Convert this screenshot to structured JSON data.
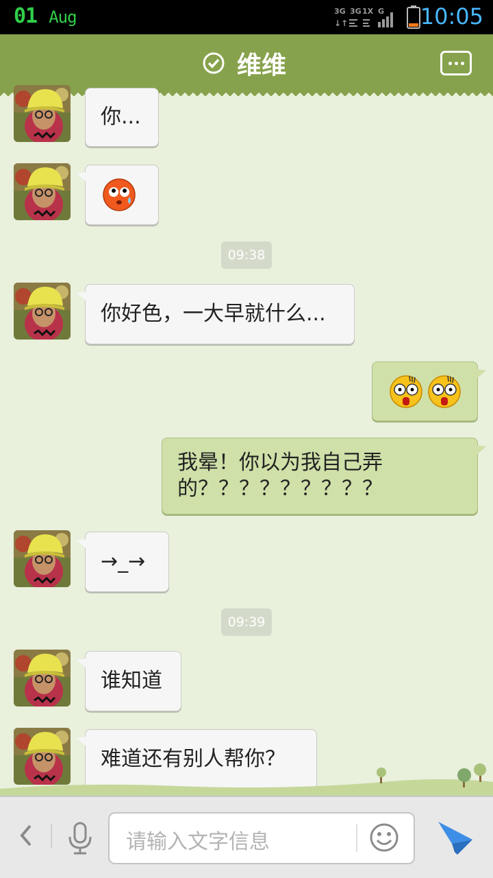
{
  "status_bar": {
    "date_day": "01",
    "date_month": "Aug",
    "time": "10:05",
    "net_labels": [
      "3G",
      "3G",
      "1X",
      "G"
    ]
  },
  "header": {
    "title": "维维",
    "verified_icon": "check-circle-icon",
    "menu_icon": "chat-bubble-dots-icon"
  },
  "messages": [
    {
      "side": "in",
      "text": "你..."
    },
    {
      "side": "in",
      "emoji": "blushing-sweat-face"
    },
    {
      "timestamp": "09:38"
    },
    {
      "side": "in",
      "text": "你好色，一大早就什么..."
    },
    {
      "side": "out",
      "emoji": "shocked-faces-x2"
    },
    {
      "side": "out",
      "text": "我晕！你以为我自己弄\n的？？？？？？？？？"
    },
    {
      "side": "in",
      "text": "→_→"
    },
    {
      "timestamp": "09:39"
    },
    {
      "side": "in",
      "text": "谁知道"
    },
    {
      "side": "in",
      "text": "难道还有别人帮你？"
    }
  ],
  "input_bar": {
    "placeholder": "请输入文字信息",
    "back_icon": "chevron-left-icon",
    "mic_icon": "microphone-icon",
    "emoji_icon": "smiley-icon",
    "send_icon": "paper-plane-icon"
  },
  "colors": {
    "header_green": "#87a24c",
    "chat_bg": "#e9f0dc",
    "outgoing_bubble": "#cfe0a8",
    "time_blue": "#49b8ff",
    "date_green": "#2fd04a"
  }
}
